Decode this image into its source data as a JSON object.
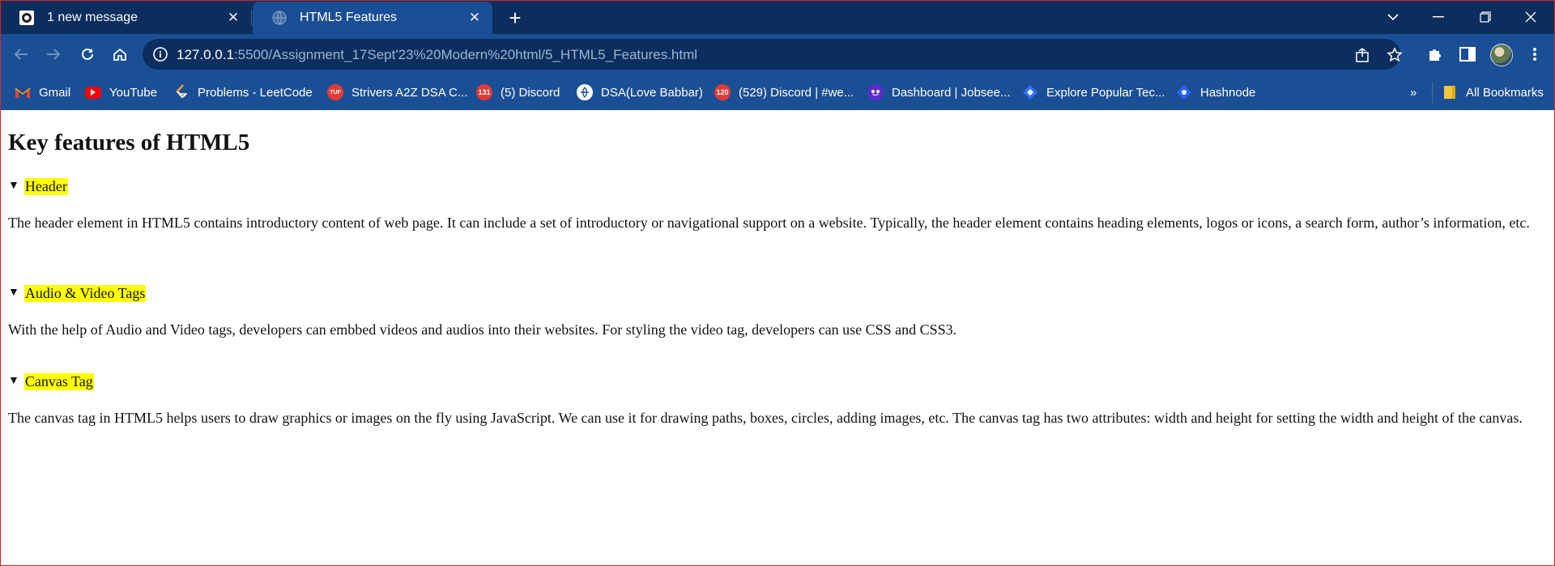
{
  "browser": {
    "tabs": [
      {
        "title": "1 new message",
        "favicon": "github-cat-icon"
      },
      {
        "title": "HTML5 Features",
        "favicon": "globe-icon"
      }
    ],
    "address": {
      "host": "127.0.0.1",
      "path": ":5500/Assignment_17Sept'23%20Modern%20html/5_HTML5_Features.html"
    },
    "bookmarks": [
      {
        "label": "Gmail",
        "icon": "gmail-icon"
      },
      {
        "label": "YouTube",
        "icon": "youtube-icon"
      },
      {
        "label": "Problems - LeetCode",
        "icon": "leetcode-icon"
      },
      {
        "label": "Strivers A2Z DSA C...",
        "icon": "tuf-icon",
        "badge": "TUF"
      },
      {
        "label": "(5) Discord",
        "icon": "discord-icon",
        "badge": "131"
      },
      {
        "label": "DSA(Love Babbar)",
        "icon": "codehelp-icon"
      },
      {
        "label": "(529) Discord | #we...",
        "icon": "discord-icon",
        "badge": "120"
      },
      {
        "label": "Dashboard | Jobsee...",
        "icon": "jobseeker-icon"
      },
      {
        "label": "Explore Popular Tec...",
        "icon": "diamond-icon"
      },
      {
        "label": "Hashnode",
        "icon": "hashnode-icon"
      }
    ],
    "overflow_label": "»",
    "all_bookmarks_label": "All Bookmarks"
  },
  "page": {
    "heading": "Key features of HTML5",
    "sections": [
      {
        "summary": "Header",
        "text": "The header element in HTML5 contains introductory content of web page. It can include a set of introductory or navigational support on a website. Typically, the header element contains heading elements, logos or icons, a search form, author’s information, etc."
      },
      {
        "summary": "Audio & Video Tags",
        "text": "With the help of Audio and Video tags, developers can embbed videos and audios into their websites. For styling the video tag, developers can use CSS and CSS3."
      },
      {
        "summary": "Canvas Tag",
        "text": "The canvas tag in HTML5 helps users to draw graphics or images on the fly using JavaScript. We can use it for drawing paths, boxes, circles, adding images, etc. The canvas tag has two attributes: width and height for setting the width and height of the canvas."
      }
    ],
    "disclosure_marker": "▼"
  },
  "colors": {
    "tabstrip": "#0b2e5e",
    "toolbar": "#1b4f95",
    "highlight": "#ffff00"
  }
}
